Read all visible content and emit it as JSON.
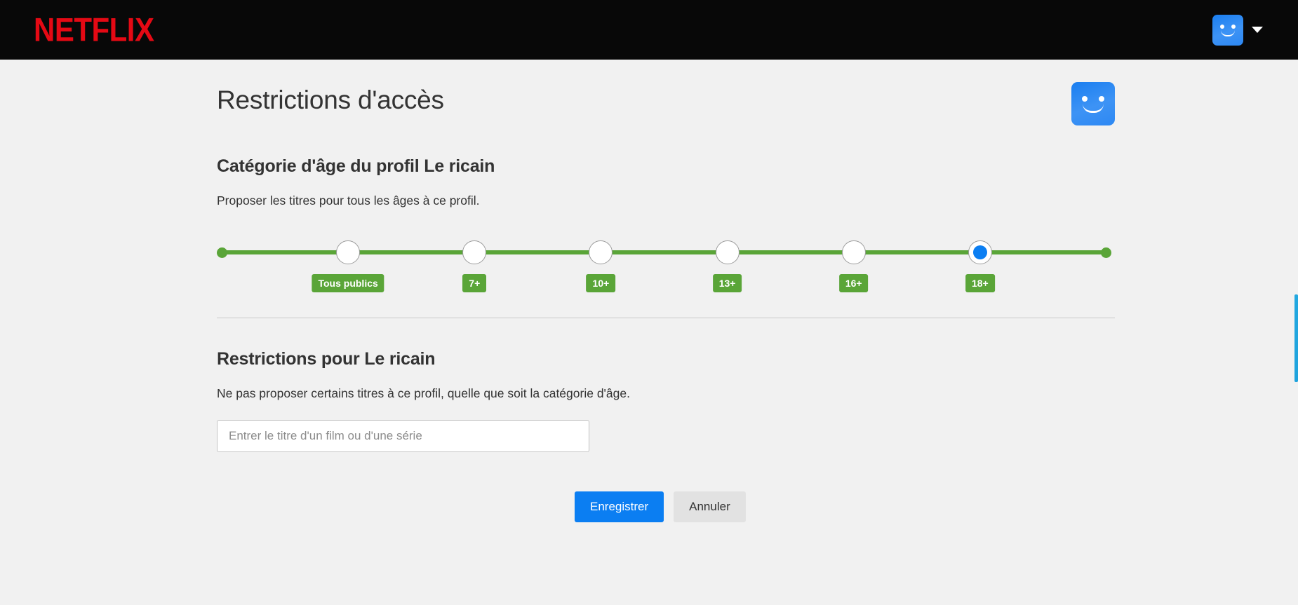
{
  "topbar": {
    "brand": "NETFLIX",
    "avatar_icon": "smiley-avatar-icon",
    "chevron_icon": "chevron-down-icon"
  },
  "header": {
    "title": "Restrictions d'accès",
    "profile_avatar_icon": "smiley-avatar-icon"
  },
  "maturity": {
    "heading": "Catégorie d'âge du profil Le ricain",
    "description": "Proposer les titres pour tous les âges à ce profil.",
    "selected_index": 5,
    "stops": [
      {
        "label": "Tous publics",
        "selected": false
      },
      {
        "label": "7+",
        "selected": false
      },
      {
        "label": "10+",
        "selected": false
      },
      {
        "label": "13+",
        "selected": false
      },
      {
        "label": "16+",
        "selected": false
      },
      {
        "label": "18+",
        "selected": true
      }
    ]
  },
  "restrictions": {
    "heading": "Restrictions pour Le ricain",
    "description": "Ne pas proposer certains titres à ce profil, quelle que soit la catégorie d'âge.",
    "input_placeholder": "Entrer le titre d'un film ou d'une série",
    "input_value": ""
  },
  "actions": {
    "save_label": "Enregistrer",
    "cancel_label": "Annuler"
  },
  "colors": {
    "brand_red": "#e50914",
    "topbar_black": "#080808",
    "page_background": "#f1f1f1",
    "slider_green": "#5aa538",
    "accent_blue": "#0b7ef2",
    "secondary_grey": "#e2e2e2",
    "text": "#333333"
  }
}
